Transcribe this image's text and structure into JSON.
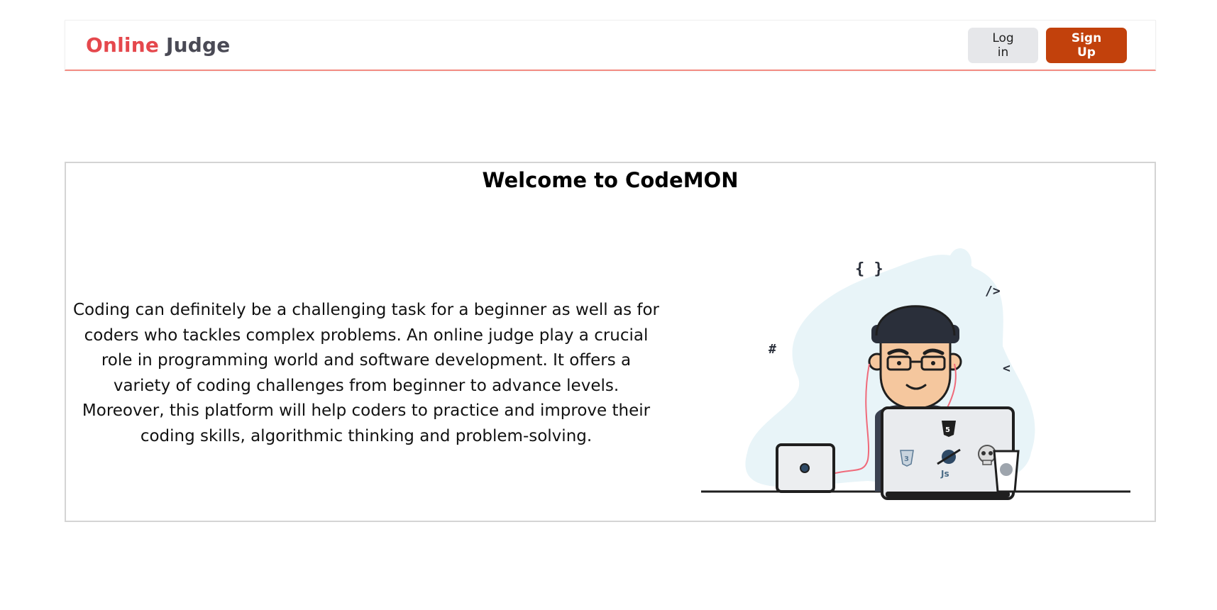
{
  "navbar": {
    "brand_online": "Online",
    "brand_judge": "Judge",
    "login_label": "Log in",
    "signup_label": "Sign Up"
  },
  "hero": {
    "title": "Welcome to CodeMON",
    "description": "Coding can definitely be a challenging task for a beginner as well as for coders who tackles complex problems. An online judge play a crucial role in programming world and software development. It offers a variety of coding challenges from beginner to advance levels. Moreover, this platform will help coders to practice and improve their coding skills, algorithmic thinking and problem-solving.",
    "illustration": {
      "icon": "coder-illustration",
      "symbols": [
        "{ }",
        "/>",
        "#",
        "<"
      ],
      "laptop_text": "Js"
    }
  },
  "colors": {
    "brand_online": "#e5484d",
    "brand_judge": "#4a4a55",
    "signup_bg": "#c2410c",
    "login_bg": "#e6e7ea",
    "navbar_border": "#f28b82",
    "blob": "#e8f4f8"
  }
}
